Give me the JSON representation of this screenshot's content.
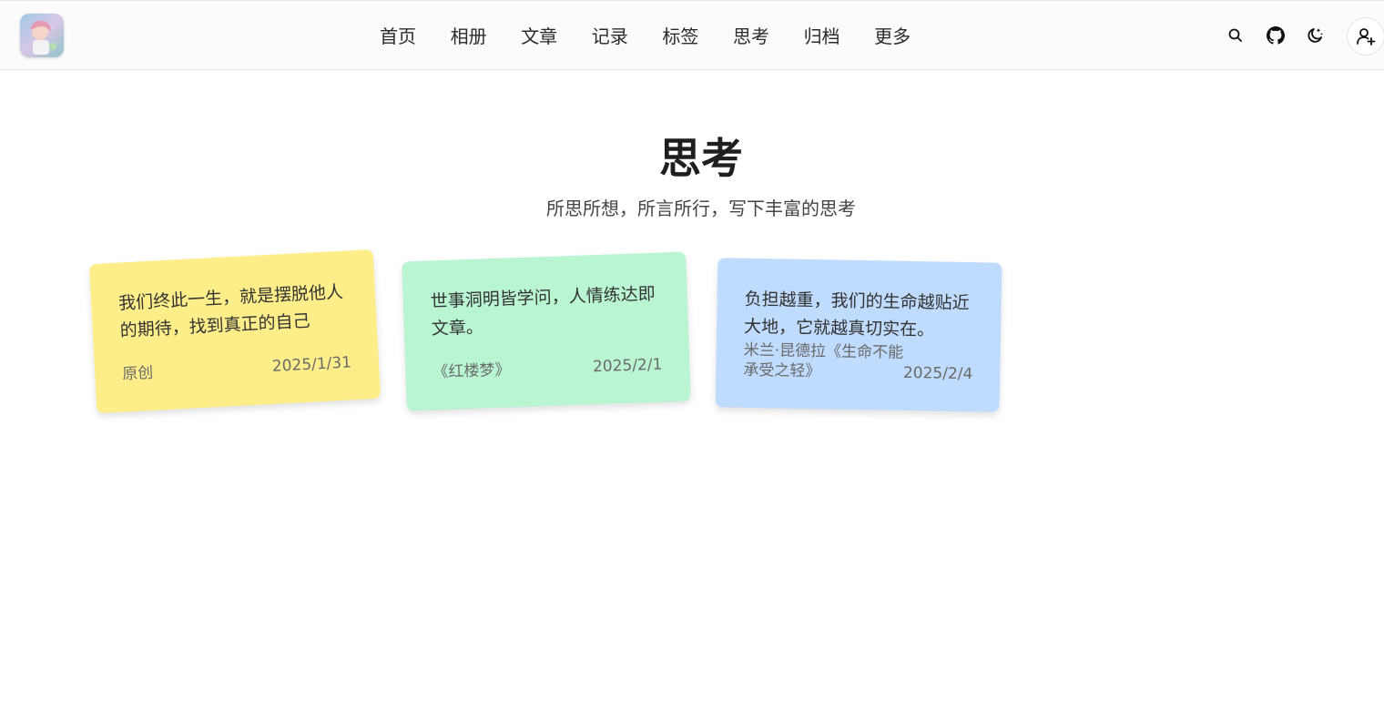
{
  "nav": {
    "links": [
      "首页",
      "相册",
      "文章",
      "记录",
      "标签",
      "思考",
      "归档",
      "更多"
    ],
    "icons": [
      "search-icon",
      "github-icon",
      "theme-toggle-icon",
      "user-add-icon"
    ]
  },
  "page": {
    "title": "思考",
    "subtitle": "所思所想，所言所行，写下丰富的思考"
  },
  "cards": [
    {
      "quote": "我们终此一生，就是摆脱他人的期待，找到真正的自己",
      "source": "原创",
      "date": "2025/1/31",
      "color": "#fdee8a"
    },
    {
      "quote": "世事洞明皆学问，人情练达即文章。",
      "source": "《红楼梦》",
      "date": "2025/2/1",
      "color": "#b9f5d2"
    },
    {
      "quote": "负担越重，我们的生命越贴近大地，它就越真切实在。",
      "source": "米兰·昆德拉《生命不能承受之轻》",
      "date": "2025/2/4",
      "color": "#bfdbfe"
    }
  ]
}
